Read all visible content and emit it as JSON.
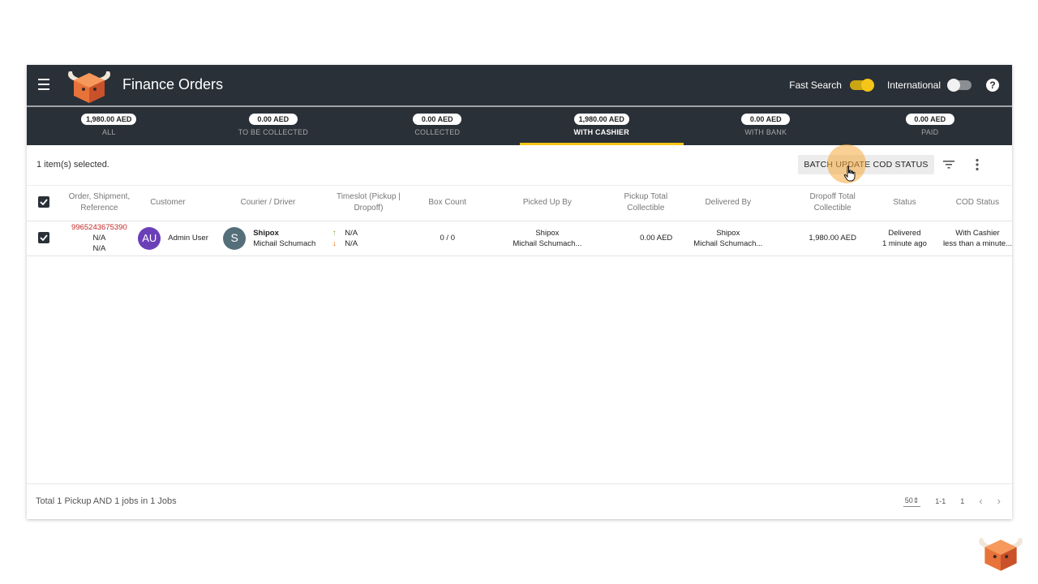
{
  "header": {
    "title": "Finance Orders",
    "fast_search_label": "Fast Search",
    "international_label": "International",
    "help_glyph": "?"
  },
  "tabs": [
    {
      "amount": "1,980.00 AED",
      "label": "ALL",
      "active": false
    },
    {
      "amount": "0.00 AED",
      "label": "TO BE COLLECTED",
      "active": false
    },
    {
      "amount": "0.00 AED",
      "label": "COLLECTED",
      "active": false
    },
    {
      "amount": "1,980.00 AED",
      "label": "WITH CASHIER",
      "active": true
    },
    {
      "amount": "0.00 AED",
      "label": "WITH BANK",
      "active": false
    },
    {
      "amount": "0.00 AED",
      "label": "PAID",
      "active": false
    }
  ],
  "toolbar": {
    "selection_text": "1 item(s) selected.",
    "batch_button_label": "BATCH UPDATE COD STATUS"
  },
  "table": {
    "headers": {
      "order": "Order, Shipment, Reference",
      "customer": "Customer",
      "courier": "Courier / Driver",
      "timeslot": "Timeslot (Pickup | Dropoff)",
      "box_count": "Box Count",
      "picked_up_by": "Picked Up By",
      "pickup_total": "Pickup Total Collectible",
      "delivered_by": "Delivered By",
      "dropoff_total": "Dropoff Total Collectible",
      "status": "Status",
      "cod_status": "COD Status"
    },
    "rows": [
      {
        "order_number": "9965243675390",
        "shipment": "N/A",
        "reference": "N/A",
        "customer_initials": "AU",
        "customer_name": "Admin User",
        "courier_initial": "S",
        "courier_name": "Shipox",
        "driver_name": "Michail Schumach",
        "pickup_slot": "N/A",
        "dropoff_slot": "N/A",
        "box_count": "0 / 0",
        "picked_up_company": "Shipox",
        "picked_up_driver": "Michail Schumach...",
        "pickup_total": "0.00 AED",
        "delivered_company": "Shipox",
        "delivered_driver": "Michail Schumach...",
        "dropoff_total": "1,980.00 AED",
        "status": "Delivered",
        "status_time": "1 minute ago",
        "cod_status": "With Cashier",
        "cod_time": "less than a minute..."
      }
    ]
  },
  "footer": {
    "summary": "Total 1 Pickup AND 1 jobs in 1 Jobs",
    "per_page": "50",
    "range": "1-1",
    "total": "1"
  },
  "colors": {
    "topbar": "#2a3037",
    "accent": "#f5c518",
    "order_link": "#c62828",
    "avatar_customer": "#6b3fb8",
    "avatar_courier": "#546e7a"
  }
}
